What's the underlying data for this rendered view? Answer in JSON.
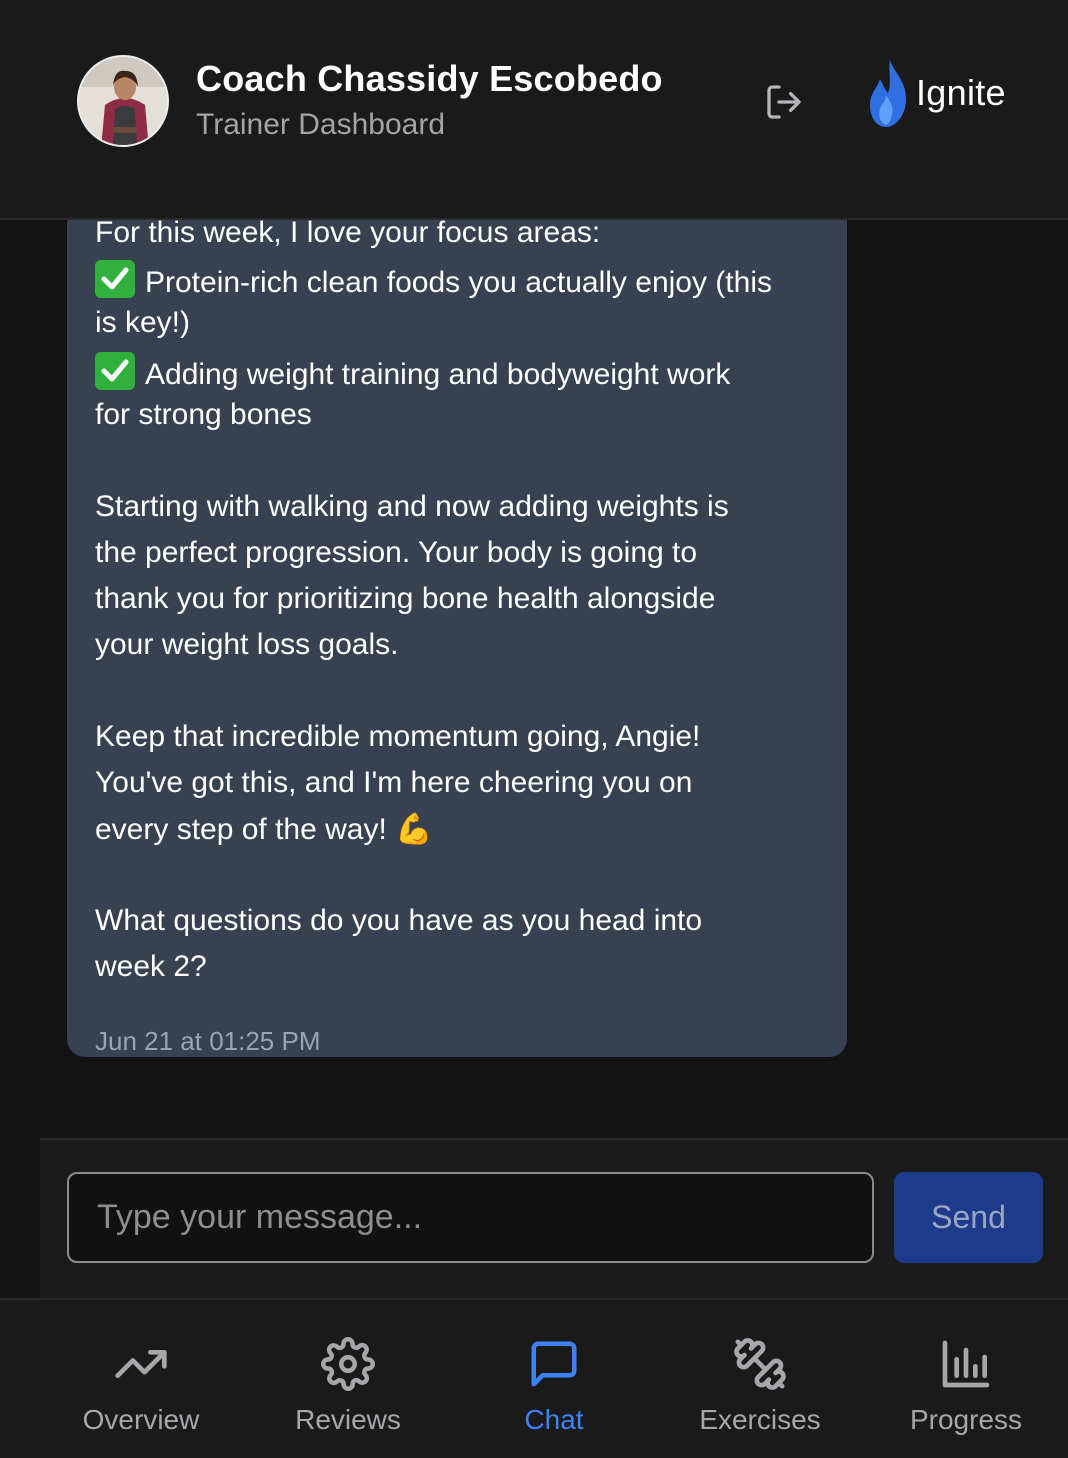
{
  "header": {
    "coach_name": "Coach Chassidy Escobedo",
    "subtitle": "Trainer Dashboard",
    "logout_icon": "logout-icon",
    "brand_name": "Ignite",
    "brand_icon": "flame-icon"
  },
  "message": {
    "lines": [
      "For this week, I love your focus areas:",
      "Protein-rich clean foods you actually enjoy (this",
      "is key!)",
      "Adding weight training and bodyweight work",
      "for strong bones",
      "Starting with walking and now adding weights is",
      "the perfect progression. Your body is going to",
      "thank you for prioritizing bone health alongside",
      "your weight loss goals.",
      "Keep that incredible momentum going, Angie!",
      "You've got this, and I'm here cheering you on",
      "every step of the way! 💪",
      "What questions do you have as you head into",
      "week 2?"
    ],
    "timestamp": "Jun 21 at 01:25 PM"
  },
  "composer": {
    "placeholder": "Type your message...",
    "send_label": "Send"
  },
  "nav": {
    "items": [
      {
        "label": "Overview",
        "icon": "trending-up-icon"
      },
      {
        "label": "Reviews",
        "icon": "gear-icon"
      },
      {
        "label": "Chat",
        "icon": "chat-bubble-icon",
        "active": true
      },
      {
        "label": "Exercises",
        "icon": "dumbbell-icon"
      },
      {
        "label": "Progress",
        "icon": "bar-chart-icon"
      }
    ]
  },
  "colors": {
    "accent": "#3b82f6",
    "bubble": "#374151",
    "send_button": "#1e3a8a",
    "check_green": "#30b13e"
  }
}
